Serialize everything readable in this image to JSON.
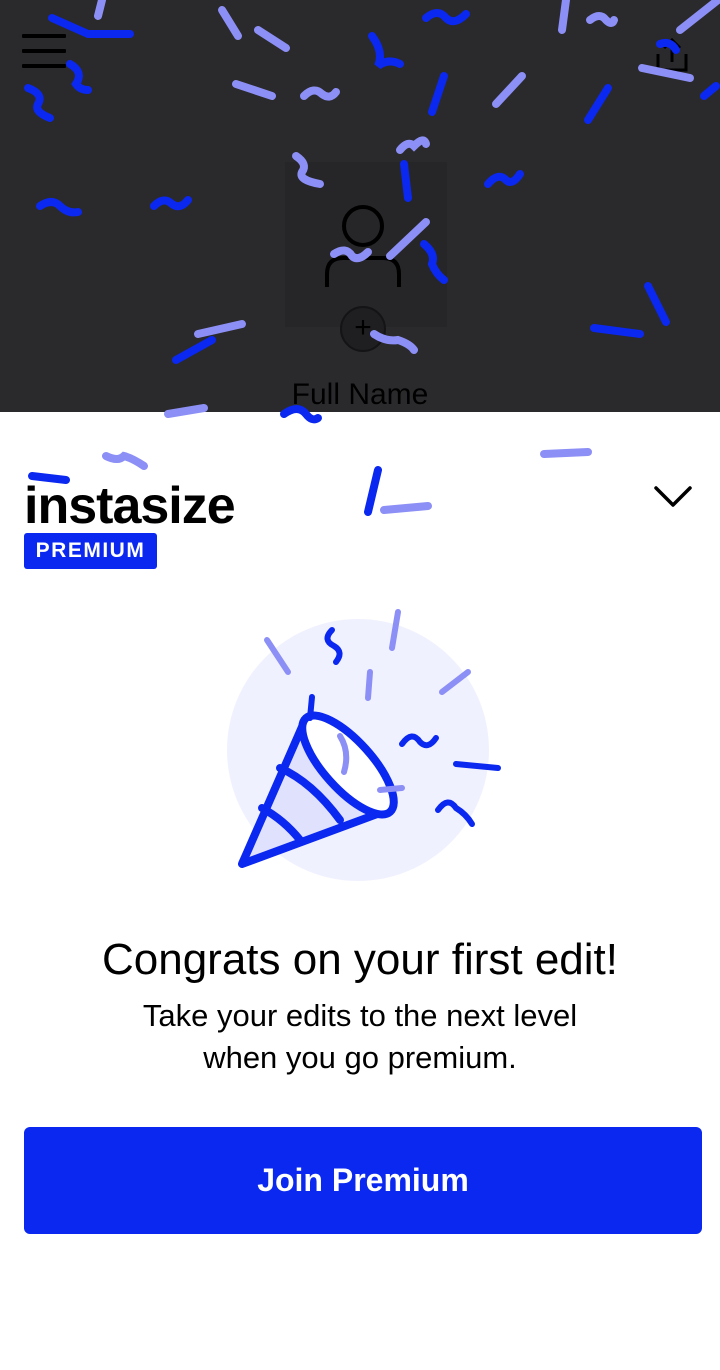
{
  "profile": {
    "full_name": "Full Name",
    "add_photo_symbol": "+"
  },
  "icons": {
    "menu": "hamburger-menu-icon",
    "share": "share-icon",
    "avatar": "person-icon",
    "collapse": "chevron-down-icon",
    "illustration": "party-popper-icon"
  },
  "brand": {
    "wordmark": "instasize",
    "badge": "PREMIUM"
  },
  "promo": {
    "title": "Congrats on your first edit!",
    "subtitle_line1": "Take your edits to the next level",
    "subtitle_line2": "when you go premium.",
    "cta_label": "Join Premium"
  },
  "colors": {
    "accent": "#0a28f0",
    "confetti_light": "#8c8ff5",
    "backdrop": "#2a292c"
  }
}
